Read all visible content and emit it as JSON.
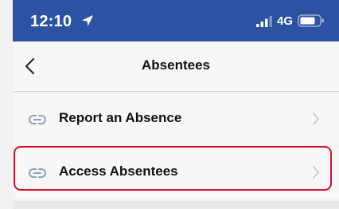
{
  "status_bar": {
    "time": "12:10",
    "network": "4G",
    "icons": [
      "location-arrow-icon",
      "signal-bars-icon",
      "battery-icon"
    ]
  },
  "nav": {
    "back_icon": "chevron-left-icon",
    "title": "Absentees"
  },
  "menu": {
    "items": [
      {
        "label": "Report an Absence",
        "icon": "link-icon",
        "trailing_icon": "chevron-right-icon"
      },
      {
        "label": "Access Absentees",
        "icon": "link-icon",
        "trailing_icon": "chevron-right-icon",
        "highlighted": true
      }
    ]
  },
  "colors": {
    "status_bar_bg": "#2b52a3",
    "highlight_border": "#d3102a",
    "page_bg": "#f2f2f2"
  }
}
